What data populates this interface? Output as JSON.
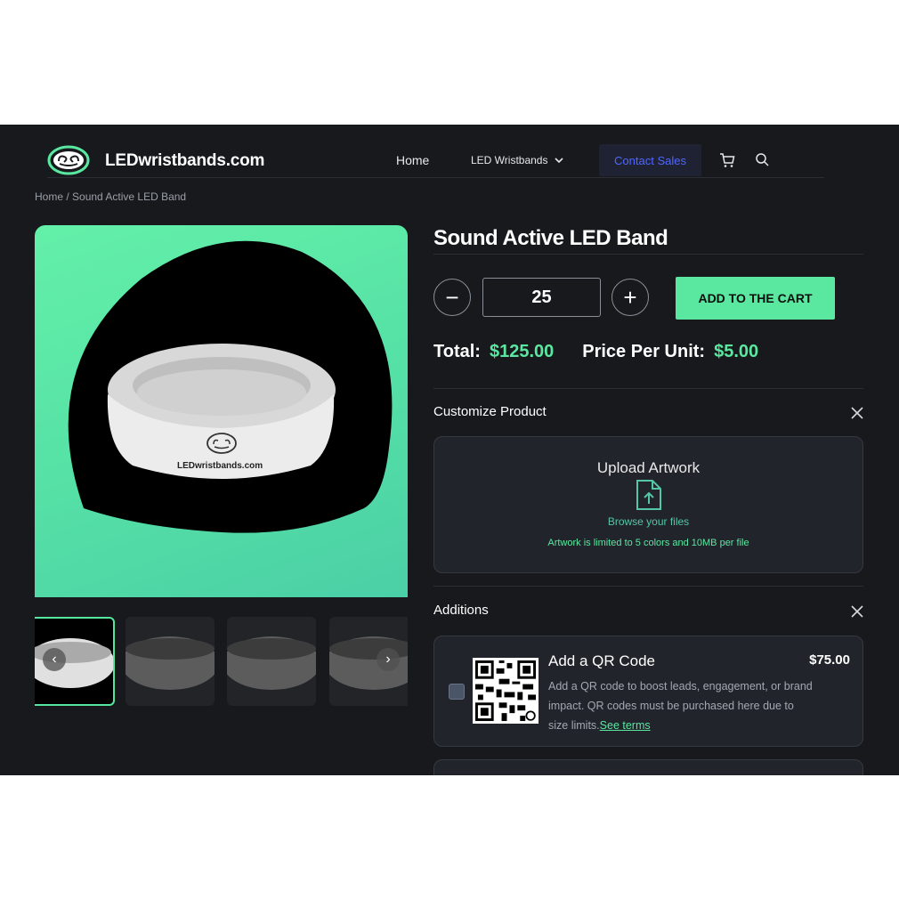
{
  "header": {
    "brand": "LEDwristbands.com",
    "nav": {
      "home": "Home",
      "led_wristbands": "LED Wristbands",
      "contact_sales": "Contact Sales"
    }
  },
  "breadcrumb": "Home / Sound Active LED Band",
  "product": {
    "title": "Sound Active LED Band",
    "image_brand_text": "LEDwristbands.com",
    "quantity": "25",
    "decrement": "−",
    "increment": "+",
    "add_to_cart": "ADD TO THE CART",
    "total_label": "Total:",
    "total_value": "$125.00",
    "unit_label": "Price Per Unit:",
    "unit_value": "$5.00"
  },
  "customize": {
    "title": "Customize Product",
    "upload_title": "Upload Artwork",
    "browse": "Browse your files",
    "limit": "Artwork is limited to 5 colors and 10MB per file"
  },
  "additions": {
    "title": "Additions",
    "qr": {
      "title": "Add a QR Code",
      "price": "$75.00",
      "desc": "Add a QR code to boost leads, engagement, or brand impact. QR codes must be purchased here due to size limits.",
      "link": "See terms",
      "checked": false
    }
  },
  "gallery": {
    "prev": "‹",
    "next": "›",
    "active_index": 0
  },
  "colors": {
    "accent": "#5ae8a0",
    "bg": "#17191d",
    "contact": "#4f67ff"
  }
}
